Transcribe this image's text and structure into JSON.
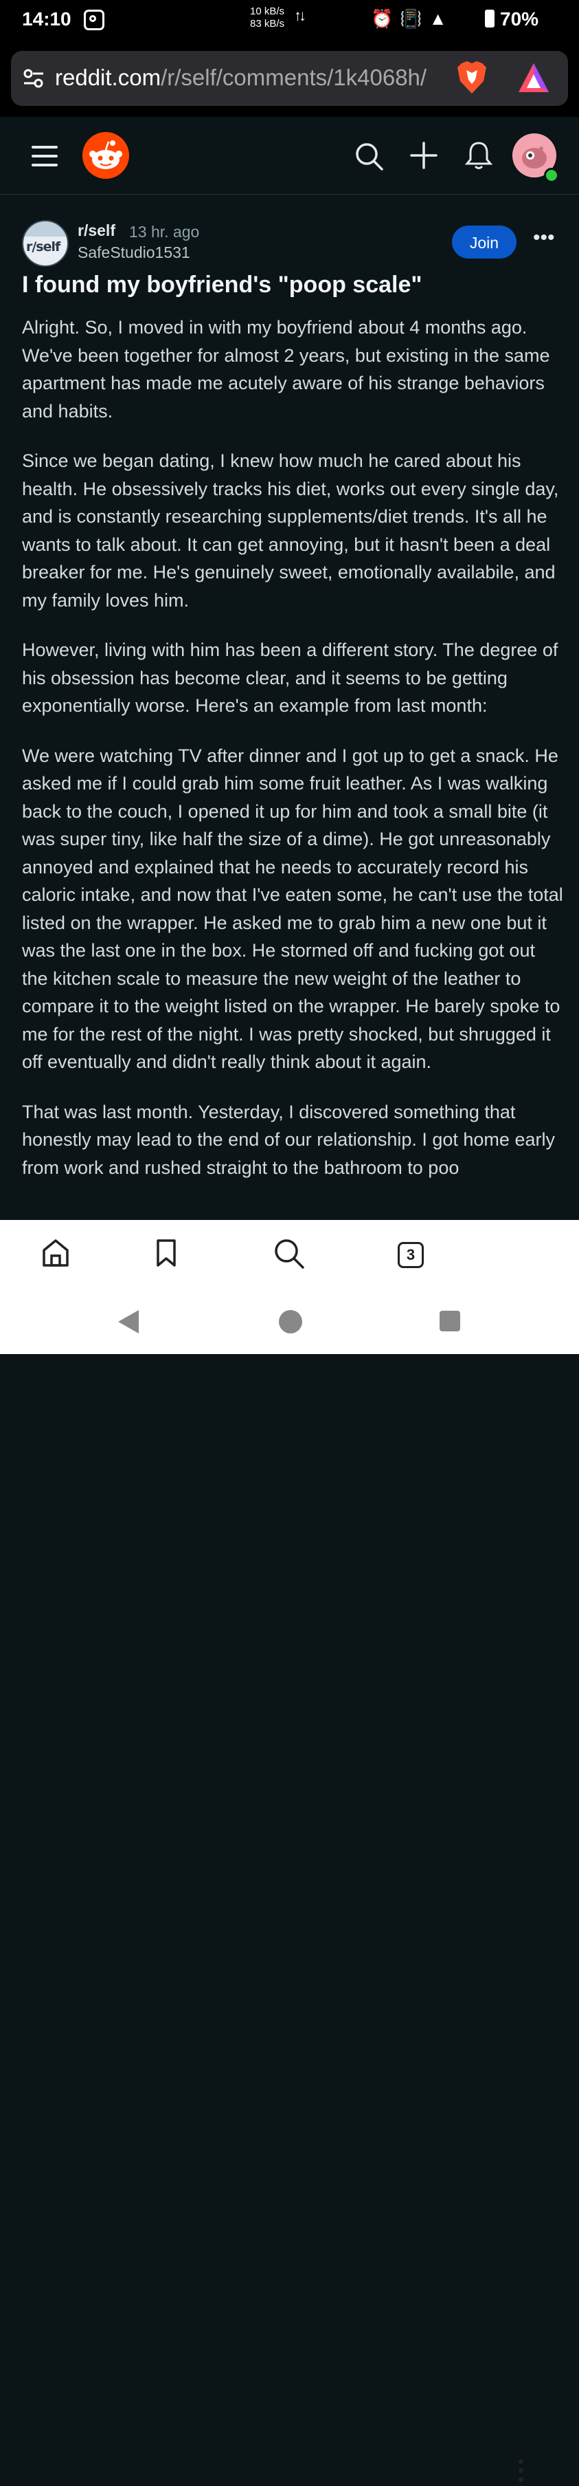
{
  "status_bar": {
    "time": "14:10",
    "speed_up": "10 kB/s",
    "speed_down": "83 kB/s",
    "battery": "70%"
  },
  "browser": {
    "url_domain": "reddit.com",
    "url_path": "/r/self/comments/1k4068h/"
  },
  "header": {
    "icons": [
      "menu-icon",
      "reddit-logo",
      "search-icon",
      "plus-icon",
      "bell-icon",
      "avatar"
    ]
  },
  "post": {
    "subreddit": "r/self",
    "subreddit_avatar_text": "r/self",
    "time_ago": "13 hr. ago",
    "author": "SafeStudio1531",
    "join_label": "Join",
    "more_label": "•••",
    "title": "I found my boyfriend's \"poop scale\"",
    "paragraphs": [
      "Alright. So, I moved in with my boyfriend about 4 months ago. We've been together for almost 2 years, but existing in the same apartment has made me acutely aware of his strange behaviors and habits.",
      "Since we began dating, I knew how much he cared about his health. He obsessively tracks his diet, works out every single day, and is constantly researching supplements/diet trends. It's all he wants to talk about. It can get annoying, but it hasn't been a deal breaker for me. He's genuinely sweet, emotionally availabile, and my family loves him.",
      "However, living with him has been a different story. The degree of his obsession has become clear, and it seems to be getting exponentially worse. Here's an example from last month:",
      "We were watching TV after dinner and I got up to get a snack. He asked me if I could grab him some fruit leather. As I was walking back to the couch, I opened it up for him and took a small bite (it was super tiny, like half the size of a dime). He got unreasonably annoyed and explained that he needs to accurately record his caloric intake, and now that I've eaten some, he can't use the total listed on the wrapper. He asked me to grab him a new one but it was the last one in the box. He stormed off and fucking got out the kitchen scale to measure the new weight of the leather to compare it to the weight listed on the wrapper. He barely spoke to me for the rest of the night. I was pretty shocked, but shrugged it off eventually and didn't really think about it again.",
      "That was last month. Yesterday, I discovered something that honestly may lead to the end of our relationship. I got home early from work and rushed straight to the bathroom to poo"
    ]
  },
  "bottom_nav": {
    "tab_count": "3",
    "icons": [
      "home-icon",
      "bookmark-icon",
      "search-icon",
      "tabs-icon",
      "more-icon"
    ]
  },
  "colors": {
    "background": "#0b1416",
    "join_button": "#0a58ca",
    "reddit_orange": "#ff4500"
  }
}
